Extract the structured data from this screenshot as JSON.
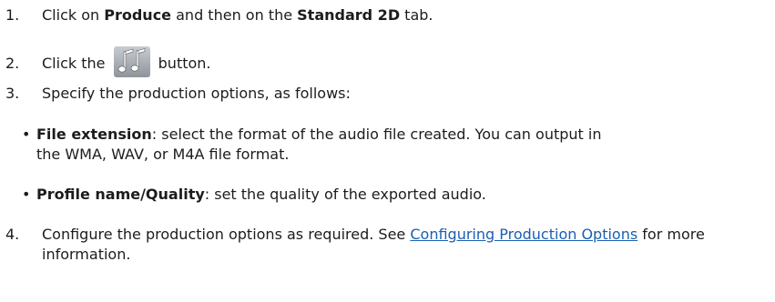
{
  "steps": [
    {
      "num": "1.",
      "prefix": "Click on ",
      "bold1": "Produce",
      "middle": " and then on the ",
      "bold2": "Standard 2D",
      "suffix": " tab."
    },
    {
      "num": "2.",
      "prefix": "Click the ",
      "button_icon": "audio-music-notes-icon",
      "suffix": " button."
    },
    {
      "num": "3.",
      "text": "Specify the production options, as follows:"
    },
    {
      "num": "4.",
      "prefix": "Configure the production options as required. See ",
      "link": "Configuring Production Options",
      "suffix": " for more information."
    }
  ],
  "bullets": [
    {
      "term": "File extension",
      "line1": ": select the format of the audio file created. You can output in",
      "line2": "the WMA, WAV, or M4A file format."
    },
    {
      "term": "Profile name/Quality",
      "text": ": set the quality of the exported audio."
    }
  ],
  "colors": {
    "text": "#1c1c1c",
    "link": "#1a5fb4"
  }
}
